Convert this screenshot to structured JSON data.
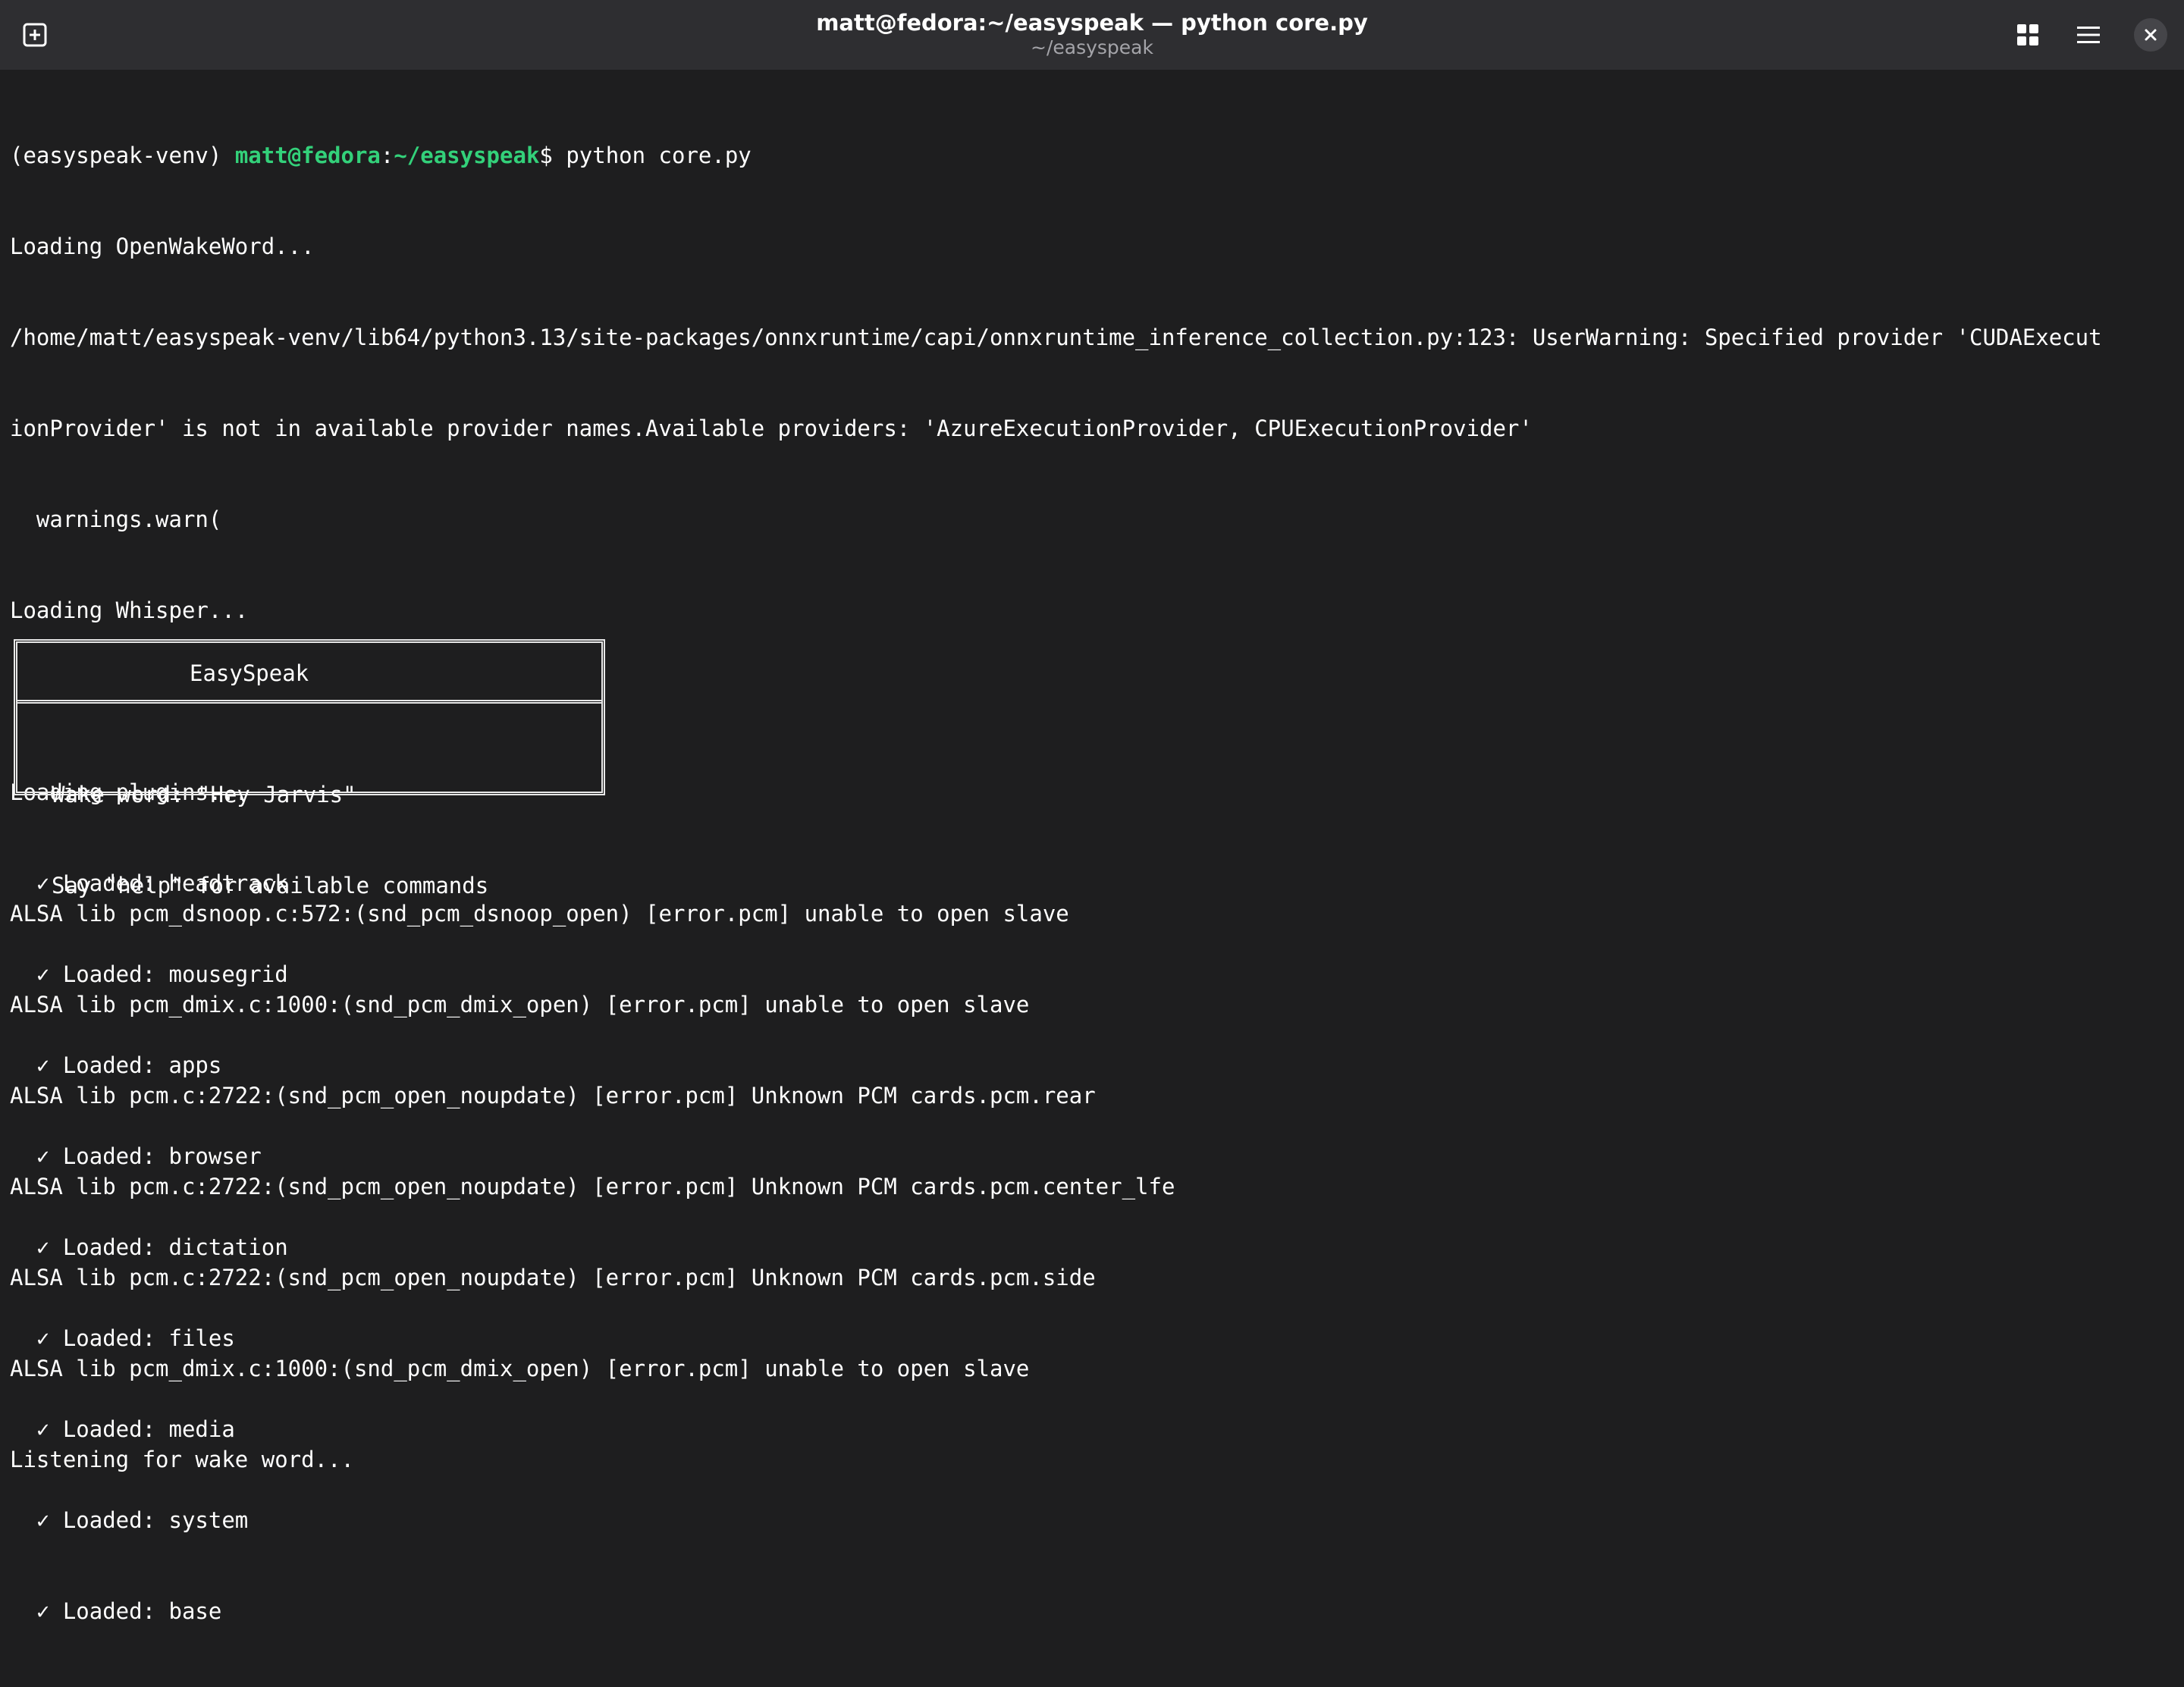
{
  "window": {
    "title": "matt@fedora:~/easyspeak — python core.py",
    "subtitle": "~/easyspeak"
  },
  "icons": {
    "new_tab": "new-tab-icon",
    "overview": "grid-icon",
    "menu": "hamburger-menu-icon",
    "close": "close-icon"
  },
  "colors": {
    "background": "#1e1e1f",
    "headerbar": "#2e2e31",
    "prompt_green": "#33d17a",
    "text": "#ffffff"
  },
  "prompt": {
    "venv": "(easyspeak-venv) ",
    "user_host": "matt@fedora",
    "colon": ":",
    "path": "~/easyspeak",
    "dollar": "$ ",
    "command": "python core.py"
  },
  "output": {
    "loading_oww": "Loading OpenWakeWord...",
    "warning_line1": "/home/matt/easyspeak-venv/lib64/python3.13/site-packages/onnxruntime/capi/onnxruntime_inference_collection.py:123: UserWarning: Specified provider 'CUDAExecut",
    "warning_line2": "ionProvider' is not in available provider names.Available providers: 'AzureExecutionProvider, CPUExecutionProvider'",
    "warnings_warn": "  warnings.warn(",
    "loading_whisper": "Loading Whisper...",
    "loading_plugins": "Loading plugins...",
    "plugins": [
      "  ✓ Loaded: headtrack",
      "  ✓ Loaded: mousegrid",
      "  ✓ Loaded: apps",
      "  ✓ Loaded: browser",
      "  ✓ Loaded: dictation",
      "  ✓ Loaded: files",
      "  ✓ Loaded: media",
      "  ✓ Loaded: system",
      "  ✓ Loaded: base"
    ]
  },
  "banner": {
    "title": "EasySpeak",
    "wake_word": "Wake word: \"Hey Jarvis\"",
    "help": "Say \"help\" for available commands"
  },
  "alsa": [
    "ALSA lib pcm_dsnoop.c:572:(snd_pcm_dsnoop_open) [error.pcm] unable to open slave",
    "ALSA lib pcm_dmix.c:1000:(snd_pcm_dmix_open) [error.pcm] unable to open slave",
    "ALSA lib pcm.c:2722:(snd_pcm_open_noupdate) [error.pcm] Unknown PCM cards.pcm.rear",
    "ALSA lib pcm.c:2722:(snd_pcm_open_noupdate) [error.pcm] Unknown PCM cards.pcm.center_lfe",
    "ALSA lib pcm.c:2722:(snd_pcm_open_noupdate) [error.pcm] Unknown PCM cards.pcm.side",
    "ALSA lib pcm_dmix.c:1000:(snd_pcm_dmix_open) [error.pcm] unable to open slave",
    "Listening for wake word..."
  ]
}
